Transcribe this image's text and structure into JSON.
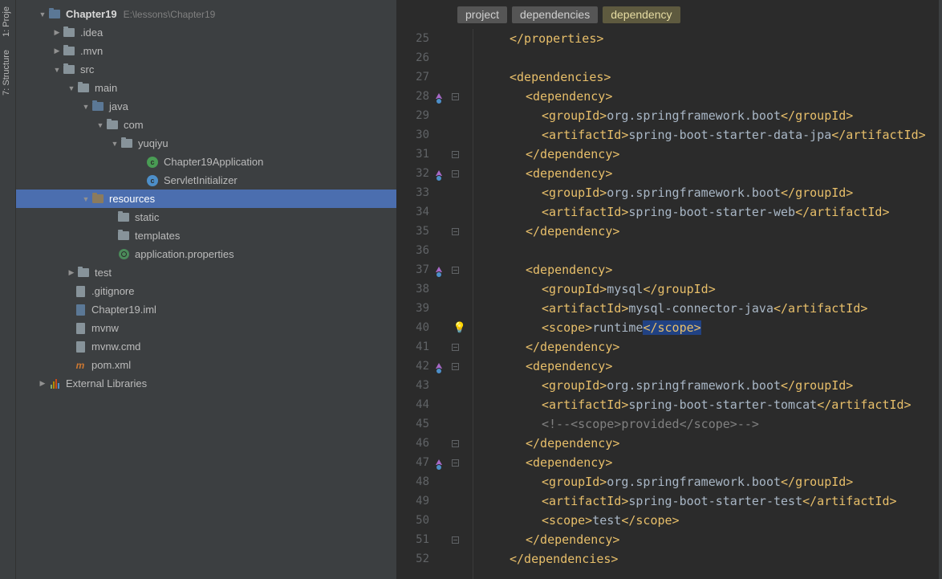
{
  "vtabs": {
    "project": "1: Proje",
    "structure": "7: Structure"
  },
  "project": {
    "rootName": "Chapter19",
    "rootPath": "E:\\lessons\\Chapter19",
    "nodes": {
      "idea": ".idea",
      "mvn": ".mvn",
      "src": "src",
      "main": "main",
      "java": "java",
      "com": "com",
      "yuqiyu": "yuqiyu",
      "app": "Chapter19Application",
      "servlet": "ServletInitializer",
      "resources": "resources",
      "static": "static",
      "templates": "templates",
      "appprops": "application.properties",
      "test": "test",
      "gitignore": ".gitignore",
      "iml": "Chapter19.iml",
      "mvnw": "mvnw",
      "mvnwcmd": "mvnw.cmd",
      "pom": "pom.xml",
      "extlib": "External Libraries"
    }
  },
  "breadcrumbs": {
    "b1": "project",
    "b2": "dependencies",
    "b3": "dependency"
  },
  "code": {
    "start": 25,
    "lines": [
      {
        "n": 25,
        "ind": 2,
        "s": [
          {
            "t": "tag",
            "v": "</properties>"
          }
        ]
      },
      {
        "n": 26,
        "ind": 0,
        "s": []
      },
      {
        "n": 27,
        "ind": 2,
        "s": [
          {
            "t": "tag",
            "v": "<dependencies>"
          }
        ]
      },
      {
        "n": 28,
        "ind": 3,
        "g": [
          "up",
          "fold"
        ],
        "s": [
          {
            "t": "tag",
            "v": "<dependency>"
          }
        ]
      },
      {
        "n": 29,
        "ind": 4,
        "s": [
          {
            "t": "tag",
            "v": "<groupId>"
          },
          {
            "t": "txt",
            "v": "org.springframework.boot"
          },
          {
            "t": "tag",
            "v": "</groupId>"
          }
        ]
      },
      {
        "n": 30,
        "ind": 4,
        "s": [
          {
            "t": "tag",
            "v": "<artifactId>"
          },
          {
            "t": "txt",
            "v": "spring-boot-starter-data-jpa"
          },
          {
            "t": "tag",
            "v": "</artifactId>"
          }
        ]
      },
      {
        "n": 31,
        "ind": 3,
        "g": [
          "",
          "foldend"
        ],
        "s": [
          {
            "t": "tag",
            "v": "</dependency>"
          }
        ]
      },
      {
        "n": 32,
        "ind": 3,
        "g": [
          "up",
          "fold"
        ],
        "s": [
          {
            "t": "tag",
            "v": "<dependency>"
          }
        ]
      },
      {
        "n": 33,
        "ind": 4,
        "s": [
          {
            "t": "tag",
            "v": "<groupId>"
          },
          {
            "t": "txt",
            "v": "org.springframework.boot"
          },
          {
            "t": "tag",
            "v": "</groupId>"
          }
        ]
      },
      {
        "n": 34,
        "ind": 4,
        "s": [
          {
            "t": "tag",
            "v": "<artifactId>"
          },
          {
            "t": "txt",
            "v": "spring-boot-starter-web"
          },
          {
            "t": "tag",
            "v": "</artifactId>"
          }
        ]
      },
      {
        "n": 35,
        "ind": 3,
        "g": [
          "",
          "foldend"
        ],
        "s": [
          {
            "t": "tag",
            "v": "</dependency>"
          }
        ]
      },
      {
        "n": 36,
        "ind": 0,
        "s": []
      },
      {
        "n": 37,
        "ind": 3,
        "g": [
          "up",
          "fold"
        ],
        "s": [
          {
            "t": "tag",
            "v": "<dependency>"
          }
        ]
      },
      {
        "n": 38,
        "ind": 4,
        "s": [
          {
            "t": "tag",
            "v": "<groupId>"
          },
          {
            "t": "txt",
            "v": "mysql"
          },
          {
            "t": "tag",
            "v": "</groupId>"
          }
        ]
      },
      {
        "n": 39,
        "ind": 4,
        "s": [
          {
            "t": "tag",
            "v": "<artifactId>"
          },
          {
            "t": "txt",
            "v": "mysql-connector-java"
          },
          {
            "t": "tag",
            "v": "</artifactId>"
          }
        ]
      },
      {
        "n": 40,
        "ind": 4,
        "g": [
          "bulb",
          ""
        ],
        "s": [
          {
            "t": "tag",
            "v": "<scope>"
          },
          {
            "t": "txt",
            "v": "runtime"
          },
          {
            "t": "tag",
            "v": "</scope>",
            "sel": true
          }
        ]
      },
      {
        "n": 41,
        "ind": 3,
        "g": [
          "",
          "foldend"
        ],
        "s": [
          {
            "t": "tag",
            "v": "</dependency>"
          }
        ]
      },
      {
        "n": 42,
        "ind": 3,
        "g": [
          "up",
          "fold"
        ],
        "s": [
          {
            "t": "tag",
            "v": "<dependency>"
          }
        ]
      },
      {
        "n": 43,
        "ind": 4,
        "s": [
          {
            "t": "tag",
            "v": "<groupId>"
          },
          {
            "t": "txt",
            "v": "org.springframework.boot"
          },
          {
            "t": "tag",
            "v": "</groupId>"
          }
        ]
      },
      {
        "n": 44,
        "ind": 4,
        "s": [
          {
            "t": "tag",
            "v": "<artifactId>"
          },
          {
            "t": "txt",
            "v": "spring-boot-starter-tomcat"
          },
          {
            "t": "tag",
            "v": "</artifactId>"
          }
        ]
      },
      {
        "n": 45,
        "ind": 4,
        "s": [
          {
            "t": "cmt",
            "v": "<!--<scope>provided</scope>-->"
          }
        ]
      },
      {
        "n": 46,
        "ind": 3,
        "g": [
          "",
          "foldend"
        ],
        "s": [
          {
            "t": "tag",
            "v": "</dependency>"
          }
        ]
      },
      {
        "n": 47,
        "ind": 3,
        "g": [
          "up",
          "fold"
        ],
        "s": [
          {
            "t": "tag",
            "v": "<dependency>"
          }
        ]
      },
      {
        "n": 48,
        "ind": 4,
        "s": [
          {
            "t": "tag",
            "v": "<groupId>"
          },
          {
            "t": "txt",
            "v": "org.springframework.boot"
          },
          {
            "t": "tag",
            "v": "</groupId>"
          }
        ]
      },
      {
        "n": 49,
        "ind": 4,
        "s": [
          {
            "t": "tag",
            "v": "<artifactId>"
          },
          {
            "t": "txt",
            "v": "spring-boot-starter-test"
          },
          {
            "t": "tag",
            "v": "</artifactId>"
          }
        ]
      },
      {
        "n": 50,
        "ind": 4,
        "s": [
          {
            "t": "tag",
            "v": "<scope>"
          },
          {
            "t": "txt",
            "v": "test"
          },
          {
            "t": "tag",
            "v": "</scope>"
          }
        ]
      },
      {
        "n": 51,
        "ind": 3,
        "g": [
          "",
          "foldend"
        ],
        "s": [
          {
            "t": "tag",
            "v": "</dependency>"
          }
        ]
      },
      {
        "n": 52,
        "ind": 2,
        "s": [
          {
            "t": "tag",
            "v": "</dependencies>"
          }
        ]
      }
    ]
  }
}
